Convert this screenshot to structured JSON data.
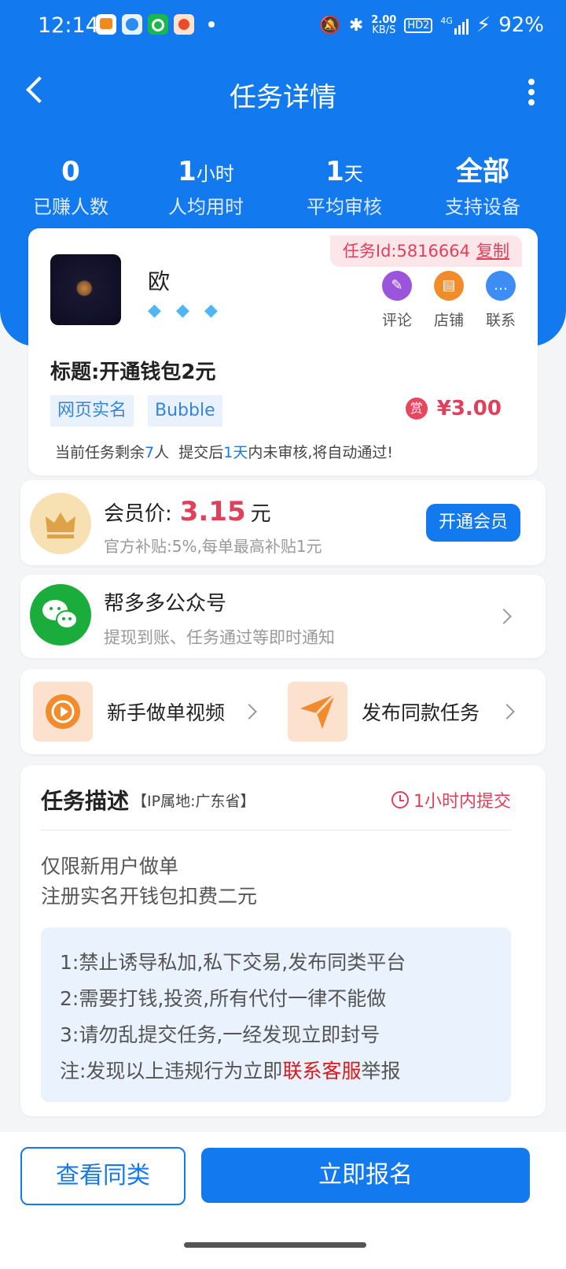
{
  "status_bar": {
    "time": "12:14",
    "battery": "92%",
    "net_speed": "2.00",
    "net_unit": "KB/S",
    "hd": "HD2",
    "signal": "4G"
  },
  "nav": {
    "title": "任务详情"
  },
  "stats": [
    {
      "value": "0",
      "unit": "",
      "label": "已赚人数"
    },
    {
      "value": "1",
      "unit": "小时",
      "label": "人均用时"
    },
    {
      "value": "1",
      "unit": "天",
      "label": "平均审核"
    },
    {
      "value": "全部",
      "unit": "",
      "label": "支持设备"
    }
  ],
  "task": {
    "id_label": "任务Id:5816664",
    "copy_label": "复制",
    "publisher_name": "欧",
    "actions": [
      {
        "label": "评论",
        "icon": "comment-icon",
        "color": "#9b55dd"
      },
      {
        "label": "店铺",
        "icon": "shop-icon",
        "color": "#f28b2c"
      },
      {
        "label": "联系",
        "icon": "chat-icon",
        "color": "#3d8df5"
      }
    ],
    "title": "标题:开通钱包2元",
    "tags": [
      "网页实名",
      "Bubble"
    ],
    "reward_badge": "赏",
    "reward": "¥3.00",
    "remaining_prefix": "当前任务剩余",
    "remaining_count": "7",
    "remaining_unit": "人",
    "remaining_mid": "提交后",
    "review_days": "1天",
    "remaining_suffix": "内未审核,将自动通过!"
  },
  "vip": {
    "label": "会员价:",
    "price": "3.15",
    "unit": "元",
    "sub": "官方补贴:5%,每单最高补贴1元",
    "button": "开通会员"
  },
  "wechat": {
    "title": "帮多多公众号",
    "sub": "提现到账、任务通过等即时通知"
  },
  "shortcuts": [
    {
      "label": "新手做单视频",
      "icon": "play-icon"
    },
    {
      "label": "发布同款任务",
      "icon": "paper-plane-icon"
    }
  ],
  "desc": {
    "title": "任务描述",
    "ip": "【IP属地:广东省】",
    "deadline": "1小时内提交",
    "lines": [
      "仅限新用户做单",
      "注册实名开钱包扣费二元"
    ],
    "rules": [
      "1:禁止诱导私加,私下交易,发布同类平台",
      "2:需要打钱,投资,所有代付一律不能做",
      "3:请勿乱提交任务,一经发现立即封号"
    ],
    "note_prefix": "注:发现以上违规行为立即",
    "note_link": "联系客服",
    "note_suffix": "举报"
  },
  "bottom": {
    "similar": "查看同类",
    "apply": "立即报名"
  }
}
